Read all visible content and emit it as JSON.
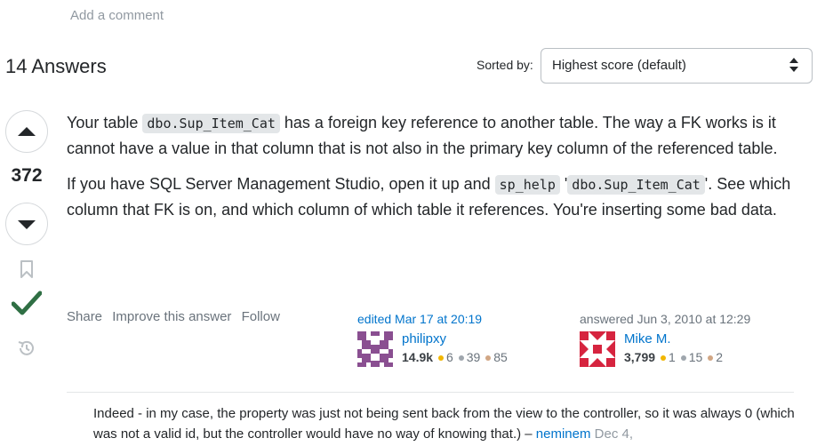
{
  "comments_link": "Add a comment",
  "header": {
    "answers_count": "14 Answers",
    "sort_label": "Sorted by:",
    "sort_value": "Highest score (default)"
  },
  "vote": {
    "score": "372",
    "accepted": true
  },
  "post": {
    "p1_a": "Your table ",
    "p1_code": "dbo.Sup_Item_Cat",
    "p1_b": " has a foreign key reference to another table. The way a FK works is it cannot have a value in that column that is not also in the primary key column of the referenced table.",
    "p2_a": "If you have SQL Server Management Studio, open it up and ",
    "p2_code1": "sp_help",
    "p2_b": " '",
    "p2_code2": "dbo.Sup_Item_Cat",
    "p2_c": "'. See which column that FK is on, and which column of which table it references. You're inserting some bad data."
  },
  "menu": {
    "share": "Share",
    "improve": "Improve this answer",
    "follow": "Follow"
  },
  "edited": {
    "time": "edited Mar 17 at 20:19",
    "user": "philipxy",
    "rep": "14.9k",
    "gold": "6",
    "silver": "39",
    "bronze": "85"
  },
  "answered": {
    "time": "answered Jun 3, 2010 at 12:29",
    "user": "Mike M.",
    "rep": "3,799",
    "gold": "1",
    "silver": "15",
    "bronze": "2"
  },
  "comment": {
    "text": "Indeed - in my case, the property was just not being sent back from the view to the controller, so it was always 0 (which was not a valid id, but the controller would have no way of knowing that.) – ",
    "user": "neminem",
    "date": "Dec 4,"
  },
  "colors": {
    "link": "#0074cc",
    "accepted": "#2f6f44",
    "muted": "#6a737c"
  }
}
